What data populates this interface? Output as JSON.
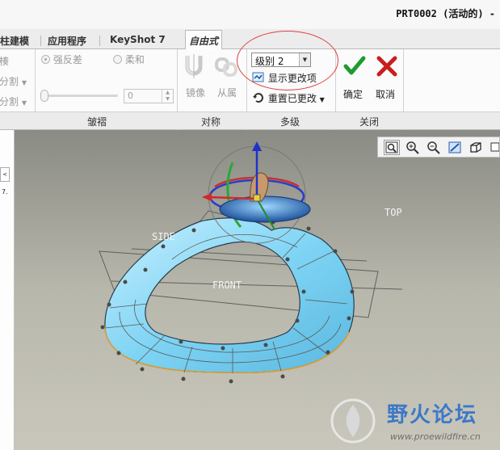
{
  "window": {
    "title": "PRT0002 (活动的) -"
  },
  "tabs": [
    {
      "label": "柱建模",
      "active": false
    },
    {
      "label": "应用程序",
      "active": false
    },
    {
      "label": "KeyShot 7",
      "active": false
    },
    {
      "label": "自由式",
      "active": true
    }
  ],
  "ribbon": {
    "crease": {
      "partial_top": "楱",
      "partial_split1": "分割",
      "partial_split2": "分割",
      "radio_strong": "强反差",
      "radio_soft": "柔和",
      "spin_value": "0",
      "group_label": "皱褶"
    },
    "symmetry": {
      "mirror_label": "镜像",
      "attach_label": "从属",
      "group_label": "对称"
    },
    "multilevel": {
      "level_value": "级别 2",
      "show_changes": "显示更改项",
      "reset_changes": "重置已更改",
      "group_label": "多级"
    },
    "close": {
      "ok_label": "确定",
      "cancel_label": "取消",
      "group_label": "关闭"
    }
  },
  "leftpanel": {
    "mini_label": "<"
  },
  "viewport": {
    "planes": {
      "top": "TOP",
      "side": "SIDE",
      "front": "FRONT"
    },
    "toolbar": [
      "zoom-fit-icon",
      "zoom-in-icon",
      "zoom-out-icon",
      "repaint-icon",
      "display-style-icon",
      "saved-views-icon"
    ]
  },
  "watermark": {
    "text": "野火论坛",
    "url": "www.proewildfire.cn"
  },
  "colors": {
    "ok": "#1f9a2f",
    "cancel": "#c81e1e",
    "highlight": "#e04040",
    "shape": "#7fd4f4"
  }
}
